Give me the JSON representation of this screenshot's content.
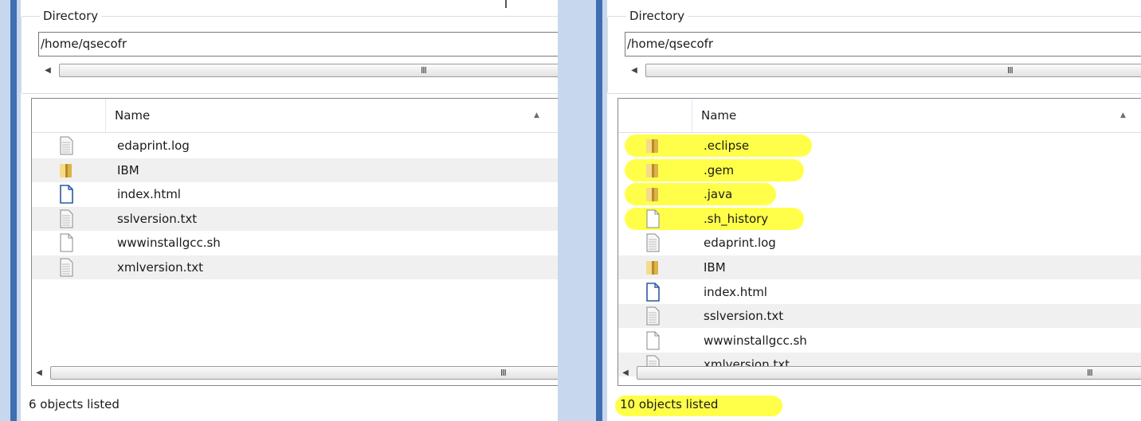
{
  "colors": {
    "highlight": "#ffff4a",
    "accent": "#3f6fb0"
  },
  "left_panel": {
    "directory": {
      "legend": "Directory",
      "value": "/home/qsecofr"
    },
    "scroll_grip": "III",
    "column_name": "Name",
    "items": [
      {
        "name": "edaprint.log",
        "icon": "text-file-icon"
      },
      {
        "name": "IBM",
        "icon": "folder-icon"
      },
      {
        "name": "index.html",
        "icon": "html-file-icon"
      },
      {
        "name": "sslversion.txt",
        "icon": "text-file-icon"
      },
      {
        "name": "wwwinstallgcc.sh",
        "icon": "blank-file-icon"
      },
      {
        "name": "xmlversion.txt",
        "icon": "text-file-icon"
      }
    ],
    "status": "6 objects listed"
  },
  "right_panel": {
    "directory": {
      "legend": "Directory",
      "value": "/home/qsecofr"
    },
    "scroll_grip": "III",
    "column_name": "Name",
    "items": [
      {
        "name": ".eclipse",
        "icon": "folder-icon",
        "highlighted": true
      },
      {
        "name": ".gem",
        "icon": "folder-icon",
        "highlighted": true
      },
      {
        "name": ".java",
        "icon": "folder-icon",
        "highlighted": true
      },
      {
        "name": ".sh_history",
        "icon": "blank-file-icon",
        "highlighted": true
      },
      {
        "name": "edaprint.log",
        "icon": "text-file-icon"
      },
      {
        "name": "IBM",
        "icon": "folder-icon"
      },
      {
        "name": "index.html",
        "icon": "html-file-icon"
      },
      {
        "name": "sslversion.txt",
        "icon": "text-file-icon"
      },
      {
        "name": "wwwinstallgcc.sh",
        "icon": "blank-file-icon"
      },
      {
        "name": "xmlversion.txt",
        "icon": "text-file-icon"
      }
    ],
    "status": "10 objects listed"
  }
}
